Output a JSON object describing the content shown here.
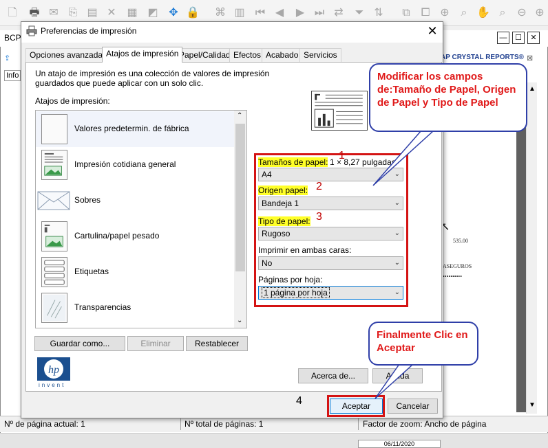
{
  "app": {
    "title": "BCP",
    "crystal_label": "AP CRYSTAL REPORTS®",
    "report_values": [
      "535.00",
      "ASEGUROS",
      "••••••••••"
    ],
    "statusbar": {
      "current_page": "Nº de página actual: 1",
      "total_pages": "Nº total de páginas: 1",
      "zoom": "Factor de zoom: Ancho de página"
    },
    "date": "06/11/2020",
    "left_tab": "Info"
  },
  "dialog": {
    "title": "Preferencias de impresión",
    "tabs": [
      "Opciones avanzadas",
      "Atajos de impresión",
      "Papel/Calidad",
      "Efectos",
      "Acabado",
      "Servicios"
    ],
    "active_tab": "Atajos de impresión",
    "description": "Un atajo de impresión es una colección de valores de impresión guardados que puede aplicar con un solo clic.",
    "shortcuts_label": "Atajos de impresión:",
    "shortcuts": [
      {
        "label": "Valores predetermin. de fábrica",
        "icon": "blank-page-icon"
      },
      {
        "label": "Impresión cotidiana general",
        "icon": "document-page-icon"
      },
      {
        "label": "Sobres",
        "icon": "envelope-icon"
      },
      {
        "label": "Cartulina/papel pesado",
        "icon": "cardstock-icon"
      },
      {
        "label": "Etiquetas",
        "icon": "labels-sheet-icon"
      },
      {
        "label": "Transparencias",
        "icon": "transparency-icon"
      }
    ],
    "buttons": {
      "save_as": "Guardar como...",
      "delete": "Eliminar",
      "reset": "Restablecer",
      "about": "Acerca de...",
      "help": "Ayuda",
      "accept": "Aceptar",
      "cancel": "Cancelar"
    },
    "fields": {
      "paper_size_label": "Tamaños de papel:",
      "paper_size_dims": "1 × 8,27 pulgadas",
      "paper_size_value": "A4",
      "paper_source_label": "Origen papel:",
      "paper_source_value": "Bandeja 1",
      "paper_type_label": "Tipo de papel:",
      "paper_type_value": "Rugoso",
      "duplex_label": "Imprimir en ambas caras:",
      "duplex_value": "No",
      "pages_per_sheet_label": "Páginas por hoja:",
      "pages_per_sheet_value": "1 página por hoja"
    },
    "logo_text": "invent"
  },
  "annotations": {
    "callout_fields": "Modificar los campos de:Tamaño de Papel, Origen de Papel y  Tipo de Papel",
    "callout_accept": "Finalmente Clic en Aceptar",
    "numbers": [
      "1",
      "2",
      "3",
      "4"
    ]
  },
  "colors": {
    "highlight": "#ffff28",
    "annotation_red": "#d41313",
    "callout_border": "#2f3fa8",
    "accent": "#0078d7"
  }
}
